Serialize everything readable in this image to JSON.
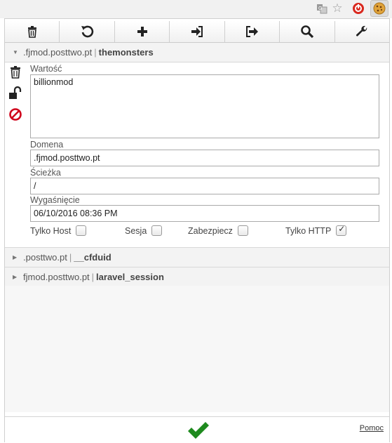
{
  "chrome": {
    "icons": [
      "translate-icon",
      "star-icon",
      "red-extension-icon",
      "cookie-icon"
    ]
  },
  "toolbar": {
    "buttons": [
      "trash-icon",
      "refresh-icon",
      "plus-icon",
      "import-icon",
      "export-icon",
      "search-icon",
      "wrench-icon"
    ]
  },
  "cookies": [
    {
      "domain": ".fjmod.posttwo.pt",
      "name": "themonsters",
      "expanded": true
    },
    {
      "domain": ".posttwo.pt",
      "name": "__cfduid",
      "expanded": false
    },
    {
      "domain": "fjmod.posttwo.pt",
      "name": "laravel_session",
      "expanded": false
    }
  ],
  "separator": "|",
  "editor": {
    "value_label": "Wartość",
    "value": "billionmod",
    "domain_label": "Domena",
    "domain": ".fjmod.posttwo.pt",
    "path_label": "Ścieżka",
    "path": "/",
    "expires_label": "Wygaśnięcie",
    "expires": "06/10/2016 08:36 PM",
    "flags": [
      {
        "label": "Tylko Host",
        "checked": false
      },
      {
        "label": "Sesja",
        "checked": false
      },
      {
        "label": "Zabezpiecz",
        "checked": false
      },
      {
        "label": "Tylko HTTP",
        "checked": true
      }
    ]
  },
  "footer": {
    "help_label": "Pomoc"
  },
  "colors": {
    "confirm": "#1e8a1e",
    "block": "#d0021b"
  }
}
